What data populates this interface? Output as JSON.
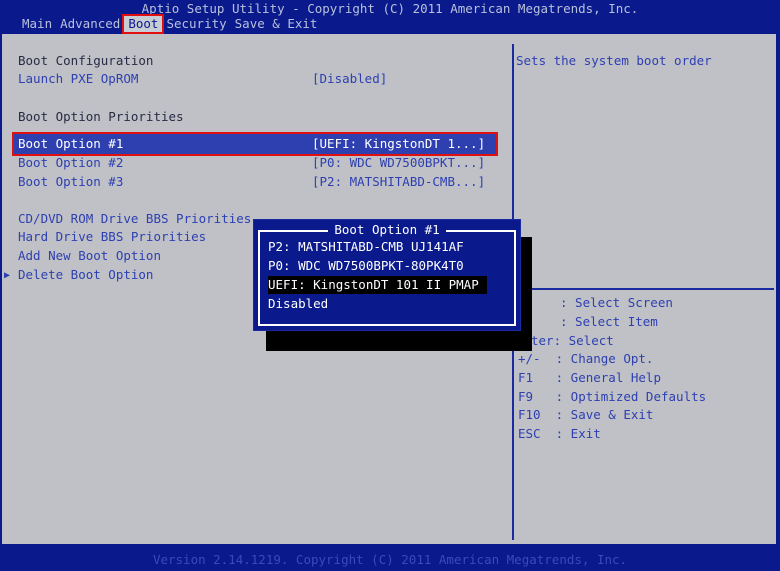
{
  "header": {
    "title": "Aptio Setup Utility - Copyright (C) 2011 American Megatrends, Inc.",
    "menu": [
      "Main",
      "Advanced",
      "Boot",
      "Security",
      "Save & Exit"
    ]
  },
  "left": {
    "boot_config_header": "Boot Configuration",
    "launch_pxe_label": "Launch PXE OpROM",
    "launch_pxe_value": "[Disabled]",
    "priorities_header": "Boot Option Priorities",
    "options": [
      {
        "label": "Boot Option #1",
        "value": "[UEFI: KingstonDT 1...]"
      },
      {
        "label": "Boot Option #2",
        "value": "[P0: WDC WD7500BPKT...]"
      },
      {
        "label": "Boot Option #3",
        "value": "[P2: MATSHITABD-CMB...]"
      }
    ],
    "cd_dvd": "CD/DVD ROM Drive BBS Priorities",
    "hdd": "Hard Drive BBS Priorities",
    "add_new": "Add New Boot Option",
    "delete": "Delete Boot Option",
    "arrow": "▶"
  },
  "popup": {
    "title": "Boot Option #1",
    "items": [
      "P2: MATSHITABD-CMB UJ141AF",
      "P0: WDC WD7500BPKT-80PK4T0",
      "UEFI: KingstonDT 101 II PMAP",
      "Disabled"
    ]
  },
  "help": {
    "description": "Sets the system boot order",
    "keys": [
      ": Select Screen",
      ": Select Item",
      "ter: Select",
      "+/-  : Change Opt.",
      "F1   : General Help",
      "F9   : Optimized Defaults",
      "F10  : Save & Exit",
      "ESC  : Exit"
    ]
  },
  "footer": "Version 2.14.1219. Copyright (C) 2011 American Megatrends, Inc."
}
